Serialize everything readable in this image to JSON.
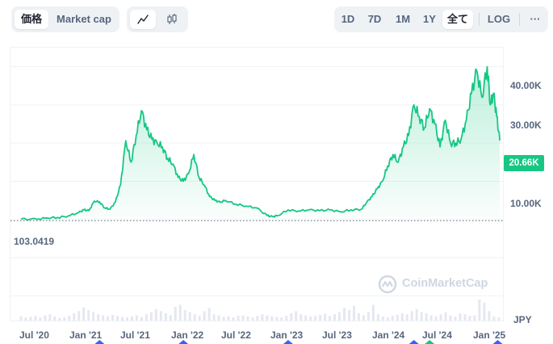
{
  "toolbar": {
    "metric_tabs": [
      {
        "label": "価格",
        "active": true
      },
      {
        "label": "Market cap",
        "active": false
      }
    ],
    "chart_type_buttons": [
      {
        "icon": "line-chart-icon",
        "active": true
      },
      {
        "icon": "candlestick-icon",
        "active": false
      }
    ],
    "ranges": [
      {
        "label": "1D",
        "active": false
      },
      {
        "label": "7D",
        "active": false
      },
      {
        "label": "1M",
        "active": false
      },
      {
        "label": "1Y",
        "active": false
      },
      {
        "label": "全て",
        "active": true
      }
    ],
    "log_label": "LOG",
    "more_label": "···"
  },
  "chart_data": {
    "type": "area",
    "y_tick_labels": [
      "40.00K",
      "30.00K",
      "10.00K"
    ],
    "y_ticks": [
      40000,
      30000,
      10000
    ],
    "ylim": [
      -26500,
      45000
    ],
    "current_price_label": "20.66K",
    "baseline_label": "103.0419",
    "baseline_value": 103.0419,
    "x_tick_labels": [
      "Jul '20",
      "Jan '21",
      "Jul '21",
      "Jan '22",
      "Jul '22",
      "Jan '23",
      "Jul '23",
      "Jan '24",
      "Jul '24",
      "Jan '25"
    ],
    "currency": "JPY",
    "watermark": "CoinMarketCap",
    "colors": {
      "line": "#16c784",
      "area_top": "#16c784",
      "grid": "#eff2f5",
      "price_tag": "#16c784"
    },
    "x": [
      2020.55,
      2020.7,
      2020.8,
      2020.9,
      2021.0,
      2021.1,
      2021.15,
      2021.2,
      2021.25,
      2021.3,
      2021.35,
      2021.4,
      2021.45,
      2021.5,
      2021.55,
      2021.6,
      2021.65,
      2021.7,
      2021.75,
      2021.8,
      2021.85,
      2021.9,
      2021.95,
      2022.0,
      2022.05,
      2022.1,
      2022.15,
      2022.2,
      2022.25,
      2022.3,
      2022.35,
      2022.4,
      2022.45,
      2022.5,
      2022.6,
      2022.7,
      2022.8,
      2022.9,
      2022.95,
      2023.0,
      2023.1,
      2023.2,
      2023.3,
      2023.4,
      2023.5,
      2023.6,
      2023.7,
      2023.8,
      2023.85,
      2023.9,
      2023.95,
      2024.0,
      2024.05,
      2024.1,
      2024.15,
      2024.2,
      2024.25,
      2024.3,
      2024.35,
      2024.4,
      2024.45,
      2024.5,
      2024.55,
      2024.6,
      2024.65,
      2024.7,
      2024.75,
      2024.8,
      2024.85,
      2024.9,
      2024.95,
      2025.0,
      2025.03,
      2025.06,
      2025.09,
      2025.12
    ],
    "y": [
      100,
      50,
      400,
      500,
      900,
      1800,
      2500,
      2300,
      4800,
      4600,
      3000,
      2700,
      4500,
      9000,
      20600,
      15000,
      22000,
      28500,
      23500,
      21000,
      20000,
      19000,
      16000,
      14500,
      11000,
      10000,
      12000,
      17000,
      11000,
      9000,
      6000,
      5000,
      4500,
      5000,
      4000,
      3500,
      3000,
      1000,
      700,
      1000,
      2500,
      2200,
      2500,
      2300,
      2500,
      2000,
      2500,
      2700,
      4500,
      6000,
      8000,
      10000,
      14000,
      17000,
      15000,
      19000,
      22000,
      30000,
      27000,
      24000,
      29000,
      25000,
      19000,
      26000,
      20000,
      20000,
      21000,
      26000,
      33000,
      39000,
      32000,
      40000,
      30000,
      33000,
      27000,
      20660
    ],
    "volume": [
      8,
      6,
      7,
      9,
      6,
      10,
      12,
      8,
      5,
      6,
      9,
      14,
      18,
      25,
      20,
      16,
      12,
      10,
      8,
      11,
      9,
      7,
      6,
      8,
      10,
      7,
      12,
      16,
      22,
      18,
      14,
      10,
      26,
      30,
      20,
      16,
      12,
      9,
      18,
      24,
      12,
      10,
      7,
      8,
      6,
      9,
      10,
      8,
      6,
      9,
      12,
      10,
      8,
      7,
      6,
      9,
      14,
      18,
      12,
      10,
      8,
      9,
      11,
      13,
      9,
      12,
      16,
      24,
      20,
      28,
      14,
      10,
      16,
      30,
      12,
      8,
      6,
      9,
      11,
      14,
      12,
      18,
      22,
      16,
      14,
      10,
      8,
      12,
      16,
      10,
      8,
      14,
      12,
      9,
      10,
      40,
      34,
      18,
      8,
      6
    ]
  }
}
